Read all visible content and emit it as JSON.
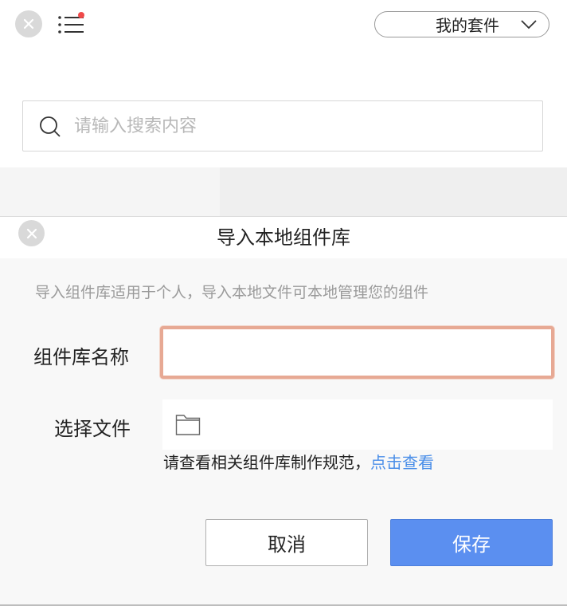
{
  "topbar": {
    "close_icon": "close-icon",
    "menu_icon": "list-menu-icon",
    "notification_dot_color": "#f04a4a",
    "kit_dropdown": {
      "label": "我的套件",
      "icon": "chevron-down-icon"
    }
  },
  "search": {
    "placeholder": "请输入搜索内容",
    "value": "",
    "icon": "search-icon"
  },
  "dialog": {
    "title": "导入本地组件库",
    "close_icon": "close-icon",
    "description": "导入组件库适用于个人，导入本地文件可本地管理您的组件",
    "name_field": {
      "label": "组件库名称",
      "value": "",
      "placeholder": ""
    },
    "file_field": {
      "label": "选择文件",
      "icon": "folder-icon"
    },
    "spec_text": "请查看相关组件库制作规范，",
    "spec_link": "点击查看",
    "cancel_label": "取消",
    "save_label": "保存",
    "colors": {
      "accent": "#5b8ff0",
      "link": "#4a8ee8",
      "input_focus_border": "#e7a994"
    }
  }
}
